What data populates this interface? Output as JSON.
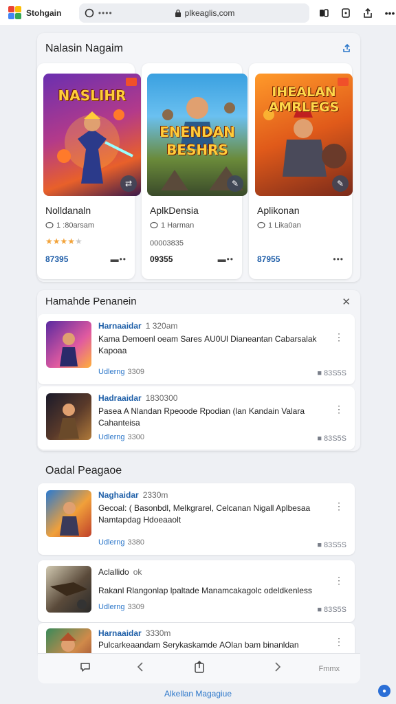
{
  "browser": {
    "brand_name": "Stohgain",
    "url_dots": "••••",
    "url_host": "plkeaglis,com"
  },
  "featured": {
    "title": "Nalasin Nagaim",
    "apps": [
      {
        "art_text": "NASLIHR",
        "name": "Nolldanaln",
        "meta": "1 :80arsam",
        "extra": "",
        "rating_stars": 4,
        "price": "87395",
        "more": "▬••"
      },
      {
        "art_text": "ENENDAN BESHRS",
        "name": "AplkDensia",
        "meta": "1 Harman",
        "extra": "00003835",
        "rating_stars": 0,
        "price": "09355",
        "more": "▬••"
      },
      {
        "art_text": "IHEALAN AMRLEGS",
        "name": "Aplikonan",
        "meta": "1 Lika0an",
        "extra": "",
        "rating_stars": 0,
        "price": "87955",
        "more": "•••"
      }
    ]
  },
  "section2": {
    "title": "Hamahde Penanein",
    "rows": [
      {
        "head": "Harnaaidar",
        "time": "1 320am",
        "body": "Kama Demoenl oeam Sares АU0Ul Dianeantan Cabarsalak Kapoaa",
        "link": "Udlerng",
        "link_num": "3309",
        "size": "83S5S"
      },
      {
        "head": "Hadraaidar",
        "time": "1830300",
        "body": "Pasea A Nlandan Rpeoode Rpodian (lan Kandain Valara Cahanteisa",
        "link": "Udlerng",
        "link_num": "3300",
        "size": "83S5S"
      }
    ]
  },
  "section3": {
    "title": "Oadal Peagaoe",
    "rows": [
      {
        "head": "Naghaidar",
        "time": "2330m",
        "body": "Gecoal: ( Basonbdl, Melkgrarel, Celcanan Nigall Aplbesaa Namtapdag Hdoeaaolt",
        "link": "Udlerng",
        "link_num": "3380",
        "size": "83S5S"
      },
      {
        "head": "Aclallido",
        "time": "ok",
        "body": "Rakanl Rlangonlap lpaltade Manamcakagolc odeldkenless",
        "link": "Udlerng",
        "link_num": "3309",
        "size": "83S5S"
      },
      {
        "head": "Harnaaidar",
        "time": "3330m",
        "body": "Pulcarkeaandam Serykaskamde АOlan bam binanldan",
        "link": "",
        "link_num": "",
        "size": ""
      }
    ]
  },
  "bottombar": {
    "right_text": "Fmmx"
  },
  "footer": {
    "link": "Alkellan Magagiue"
  },
  "colors": {
    "accent": "#2b76c9",
    "price": "#1f5ea8",
    "star": "#f2a33a"
  }
}
